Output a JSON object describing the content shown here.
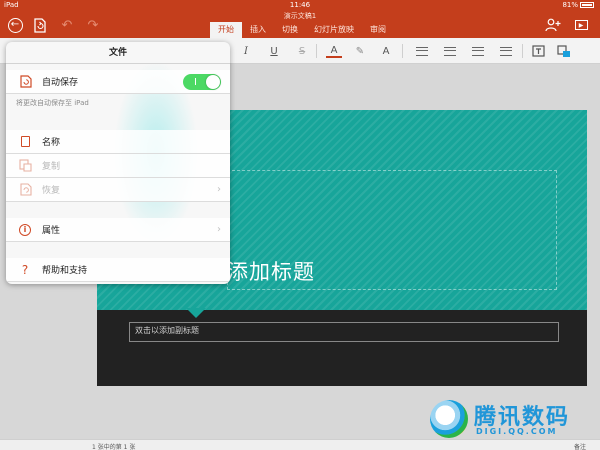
{
  "status_bar": {
    "device": "iPad",
    "time": "11:46",
    "battery": "81%"
  },
  "app": {
    "doc_title": "演示文稿1"
  },
  "ribbon": {
    "tabs": [
      {
        "label": "开始",
        "active": true
      },
      {
        "label": "插入",
        "active": false
      },
      {
        "label": "切换",
        "active": false
      },
      {
        "label": "幻灯片放映",
        "active": false
      },
      {
        "label": "审阅",
        "active": false
      }
    ],
    "accent": "#c43e1c"
  },
  "toolbar": {
    "italic_glyph": "I",
    "underline_glyph": "U",
    "strike_glyph": "S",
    "font_color_glyph": "A"
  },
  "file_menu": {
    "title": "文件",
    "autosave": {
      "label": "自动保存",
      "enabled": true,
      "note": "将更改自动保存至 iPad"
    },
    "items": [
      {
        "label": "名称",
        "icon": "document-icon",
        "enabled": true,
        "chevron": false
      },
      {
        "label": "复制",
        "icon": "duplicate-icon",
        "enabled": false,
        "chevron": false
      },
      {
        "label": "恢复",
        "icon": "restore-icon",
        "enabled": false,
        "chevron": true
      }
    ],
    "properties": {
      "label": "属性",
      "chevron": true
    },
    "help": {
      "label": "帮助和支持"
    }
  },
  "slide": {
    "title_placeholder": "添加标题",
    "subtitle_placeholder": "双击以添加副标题",
    "theme_color": "#17a59a"
  },
  "footer": {
    "slide_count": "1 张中的第 1 张",
    "notes_label": "备注"
  },
  "watermark": {
    "text": "腾讯数码",
    "sub": "DIGI.QQ.COM"
  }
}
